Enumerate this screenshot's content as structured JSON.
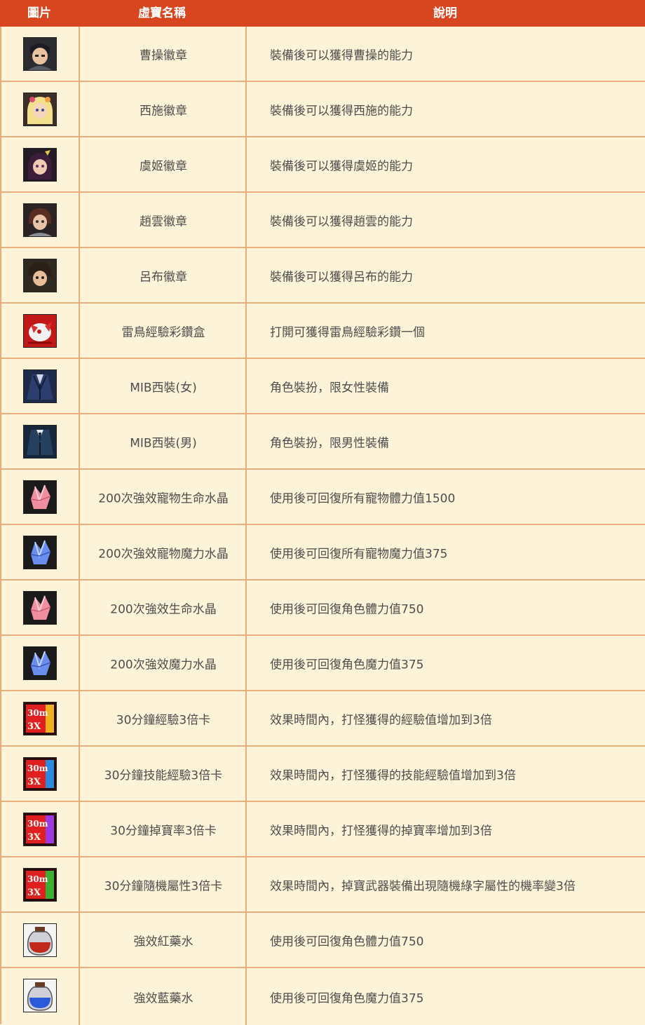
{
  "table": {
    "header": {
      "col_image": "圖片",
      "col_name": "虛寶名稱",
      "col_desc": "說明"
    },
    "colors": {
      "header_bg": "#d8461f",
      "row_bg": "#fdf3d8",
      "grid": "#e8ae7c",
      "text": "#4d4d4d"
    },
    "rows": [
      {
        "icon": "portrait-cao-cao-icon",
        "name": "曹操徽章",
        "desc": "裝備後可以獲得曹操的能力"
      },
      {
        "icon": "portrait-xi-shi-icon",
        "name": "西施徽章",
        "desc": "裝備後可以獲得西施的能力"
      },
      {
        "icon": "portrait-yu-ji-icon",
        "name": "虞姬徽章",
        "desc": "裝備後可以獲得虞姬的能力"
      },
      {
        "icon": "portrait-zhao-yun-icon",
        "name": "趙雲徽章",
        "desc": "裝備後可以獲得趙雲的能力"
      },
      {
        "icon": "portrait-lu-bu-icon",
        "name": "呂布徽章",
        "desc": "裝備後可以獲得呂布的能力"
      },
      {
        "icon": "thunderbird-giftbox-icon",
        "name": "雷鳥經驗彩鑽盒",
        "desc": "打開可獲得雷鳥經驗彩鑽一個"
      },
      {
        "icon": "suit-female-icon",
        "name": "MIB西裝(女)",
        "desc": "角色裝扮，限女性裝備"
      },
      {
        "icon": "suit-male-icon",
        "name": "MIB西裝(男)",
        "desc": "角色裝扮，限男性裝備"
      },
      {
        "icon": "pink-crystal-icon",
        "name": "200次強效寵物生命水晶",
        "desc": "使用後可回復所有寵物體力值1500"
      },
      {
        "icon": "blue-crystal-icon",
        "name": "200次強效寵物魔力水晶",
        "desc": "使用後可回復所有寵物魔力值375"
      },
      {
        "icon": "pink-crystal-icon",
        "name": "200次強效生命水晶",
        "desc": "使用後可回復角色體力值750"
      },
      {
        "icon": "blue-crystal-icon",
        "name": "200次強效魔力水晶",
        "desc": "使用後可回復角色魔力值375"
      },
      {
        "icon": "exp-card-icon",
        "name": "30分鐘經驗3倍卡",
        "desc": "效果時間內，打怪獲得的經驗值增加到3倍"
      },
      {
        "icon": "skill-exp-card-icon",
        "name": "30分鐘技能經驗3倍卡",
        "desc": "效果時間內，打怪獲得的技能經驗值增加到3倍"
      },
      {
        "icon": "drop-rate-card-icon",
        "name": "30分鐘掉寶率3倍卡",
        "desc": "效果時間內，打怪獲得的掉寶率增加到3倍"
      },
      {
        "icon": "random-attr-card-icon",
        "name": "30分鐘隨機屬性3倍卡",
        "desc": "效果時間內，掉寶武器裝備出現隨機綠字屬性的機率變3倍"
      },
      {
        "icon": "red-potion-icon",
        "name": "強效紅藥水",
        "desc": "使用後可回復角色體力值750"
      },
      {
        "icon": "blue-potion-icon",
        "name": "強效藍藥水",
        "desc": "使用後可回復角色魔力值375"
      }
    ]
  }
}
